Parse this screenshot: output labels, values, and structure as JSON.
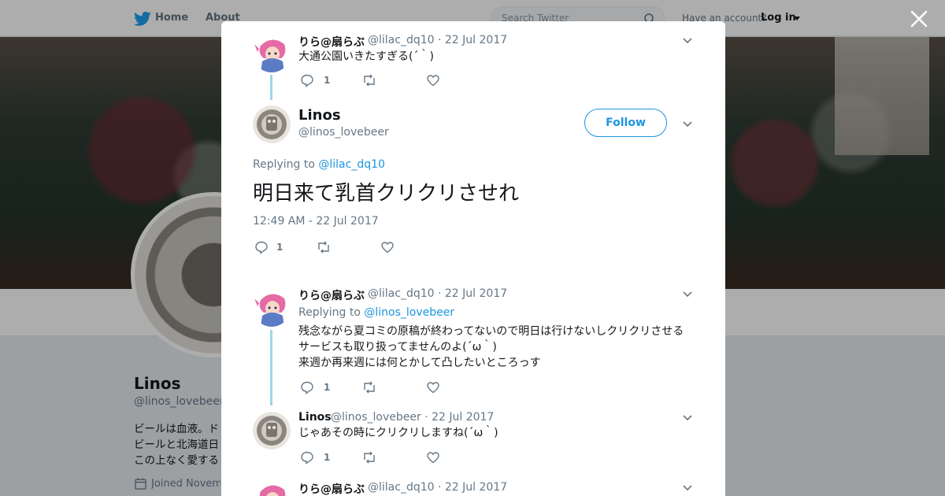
{
  "topbar": {
    "home_label": "Home",
    "about_label": "About",
    "search_placeholder": "Search Twitter",
    "have_account": "Have an account?",
    "login_label": "Log in"
  },
  "profile": {
    "name": "Linos",
    "handle": "@linos_lovebeer",
    "bio_lines": [
      "ビールは血液。ド",
      "ビールと北海道日",
      "この上なく愛する"
    ],
    "joined": "Joined Novem"
  },
  "modal": {
    "parent_tweet": {
      "name": "りら@扇らぶ",
      "handle": "@lilac_dq10",
      "date": "· 22 Jul 2017",
      "text": "大通公園いきたすぎる(´｀)",
      "reply_count": "1"
    },
    "main_tweet": {
      "name": "Linos",
      "handle": "@linos_lovebeer",
      "follow_label": "Follow",
      "replying_prefix": "Replying to",
      "replying_to": "@lilac_dq10",
      "text": "明日来て乳首クリクリさせれ",
      "timestamp": "12:49 AM - 22 Jul 2017",
      "reply_count": "1"
    },
    "replies": [
      {
        "name": "りら@扇らぶ",
        "handle": "@lilac_dq10",
        "date": "· 22 Jul 2017",
        "replying_prefix": "Replying to",
        "replying_to": "@linos_lovebeer",
        "lines": [
          "残念ながら夏コミの原稿が終わってないので明日は行けないしクリクリさせる",
          "サービスも取り扱ってませんのよ(´ω｀)",
          "来週か再来週には何とかして凸したいところっす"
        ],
        "reply_count": "1"
      },
      {
        "name": "Linos",
        "handle": "@linos_lovebeer",
        "date": "· 22 Jul 2017",
        "lines": [
          "じゃあその時にクリクリしますね(´ω｀)"
        ],
        "reply_count": "1"
      },
      {
        "name": "りら@扇らぶ",
        "handle": "@lilac_dq10",
        "date": "· 22 Jul 2017"
      }
    ]
  },
  "colors": {
    "accent": "#1b95e0",
    "thread_line": "#9fd5e8",
    "muted_text": "#657786"
  },
  "icons": [
    "twitter-bird-icon",
    "search-icon",
    "close-icon",
    "chevron-down-icon",
    "reply-icon",
    "retweet-icon",
    "like-icon",
    "calendar-icon"
  ]
}
